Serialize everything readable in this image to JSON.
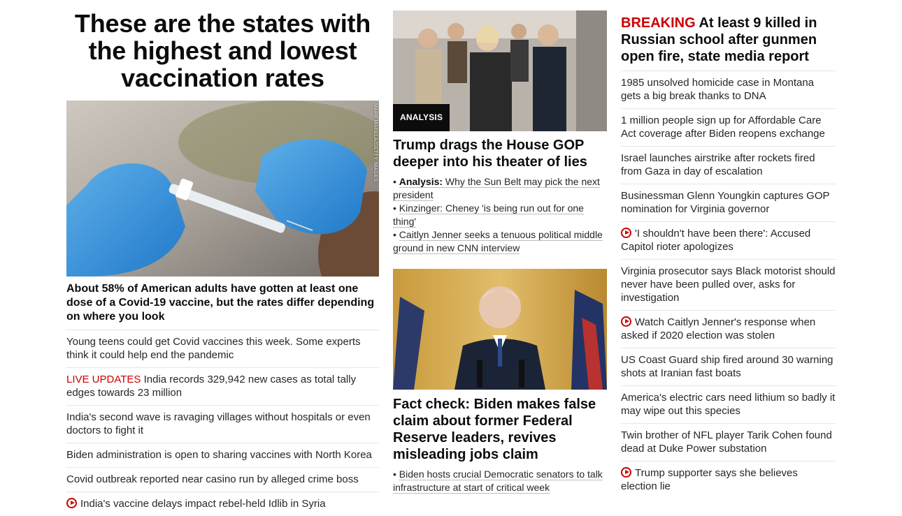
{
  "left": {
    "title": "These are the states with the highest and lowest vaccination rates",
    "image_credit": "MARK MAKELA/GETTY IMAGES",
    "subhead": "About 58% of American adults have gotten at least one dose of a Covid-19 vaccine, but the rates differ depending on where you look",
    "items": [
      {
        "text": "Young teens could get Covid vaccines this week. Some experts think it could help end the pandemic"
      },
      {
        "live": "LIVE UPDATES",
        "text": " India records 329,942 new cases as total tally edges towards 23 million"
      },
      {
        "text": "India's second wave is ravaging villages without hospitals or even doctors to fight it"
      },
      {
        "text": "Biden administration is open to sharing vaccines with North Korea"
      },
      {
        "text": "Covid outbreak reported near casino run by alleged crime boss"
      },
      {
        "text": "India's vaccine delays impact rebel-held Idlib in Syria",
        "icon": "play-icon"
      }
    ]
  },
  "middle": {
    "analysis_badge": "ANALYSIS",
    "story1_headline": "Trump drags the House GOP deeper into his theater of lies",
    "story1_bullets": [
      {
        "prefix": "Analysis:",
        "text": " Why the Sun Belt may pick the next president"
      },
      {
        "prefix": "",
        "text": "Kinzinger: Cheney 'is being run out for one thing'"
      },
      {
        "prefix": "",
        "text": "Caitlyn Jenner seeks a tenuous political middle ground in new CNN interview"
      }
    ],
    "story2_headline": "Fact check: Biden makes false claim about former Federal Reserve leaders, revives misleading jobs claim",
    "story2_bullets": [
      {
        "text": "Biden hosts crucial Democratic senators to talk infrastructure at start of critical week"
      }
    ]
  },
  "right": {
    "breaking_tag": "BREAKING",
    "breaking_headline": " At least 9 killed in Russian school after gunmen open fire, state media report",
    "items": [
      {
        "text": "1985 unsolved homicide case in Montana gets a big break thanks to DNA"
      },
      {
        "text": "1 million people sign up for Affordable Care Act coverage after Biden reopens exchange"
      },
      {
        "text": "Israel launches airstrike after rockets fired from Gaza in day of escalation"
      },
      {
        "text": "Businessman Glenn Youngkin captures GOP nomination for Virginia governor"
      },
      {
        "text": "'I shouldn't have been there': Accused Capitol rioter apologizes",
        "icon": "play-icon"
      },
      {
        "text": "Virginia prosecutor says Black motorist should never have been pulled over, asks for investigation"
      },
      {
        "text": "Watch Caitlyn Jenner's response when asked if 2020 election was stolen",
        "icon": "play-icon"
      },
      {
        "text": "US Coast Guard ship fired around 30 warning shots at Iranian fast boats"
      },
      {
        "text": "America's electric cars need lithium so badly it may wipe out this species"
      },
      {
        "text": "Twin brother of NFL player Tarik Cohen found dead at Duke Power substation"
      },
      {
        "text": "Trump supporter says she believes election lie",
        "icon": "play-icon"
      }
    ]
  },
  "colors": {
    "accent": "#cc0000",
    "headline": "#0c0c0c",
    "body": "#262626",
    "divider": "#e6e6e6"
  }
}
